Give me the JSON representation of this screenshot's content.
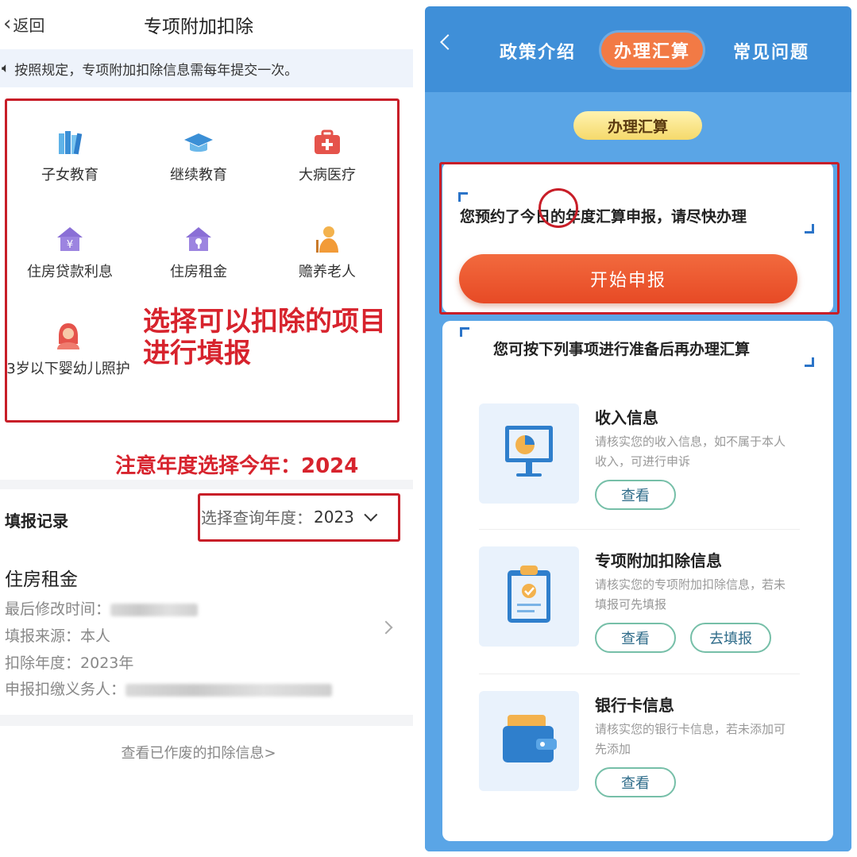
{
  "left": {
    "back_label": "返回",
    "title": "专项附加扣除",
    "notice": "按照规定，专项附加扣除信息需每年提交一次。",
    "items": [
      {
        "label": "子女教育",
        "icon": "books-icon"
      },
      {
        "label": "继续教育",
        "icon": "graduation-cap-icon"
      },
      {
        "label": "大病医疗",
        "icon": "medical-kit-icon"
      },
      {
        "label": "住房贷款利息",
        "icon": "house-yuan-icon"
      },
      {
        "label": "住房租金",
        "icon": "house-key-icon"
      },
      {
        "label": "赡养老人",
        "icon": "elderly-icon"
      },
      {
        "label": "3岁以下婴幼儿照护",
        "icon": "infant-care-icon"
      }
    ],
    "annotation_select": "选择可以扣除的项目进行填报",
    "annotation_year": "注意年度选择今年：2024",
    "records_title": "填报记录",
    "year_select_label": "选择查询年度：",
    "year_select_value": "2023",
    "record": {
      "name": "住房租金",
      "modified_label": "最后修改时间：",
      "source_label": "填报来源：",
      "source_value": "本人",
      "year_label": "扣除年度：",
      "year_value": "2023年",
      "withholder_label": "申报扣缴义务人："
    },
    "void_link": "查看已作废的扣除信息>"
  },
  "right": {
    "tabs": [
      "政策介绍",
      "办理汇算",
      "常见问题"
    ],
    "section_pill": "办理汇算",
    "appointment_text": "您预约了今日的年度汇算申报，请尽快办理",
    "start_button": "开始申报",
    "prep_text": "您可按下列事项进行准备后再办理汇算",
    "prep_items": [
      {
        "title": "收入信息",
        "desc": "请核实您的收入信息，如不属于本人收入，可进行申诉",
        "buttons": [
          "查看"
        ]
      },
      {
        "title": "专项附加扣除信息",
        "desc": "请核实您的专项附加扣除信息，若未填报可先填报",
        "buttons": [
          "查看",
          "去填报"
        ]
      },
      {
        "title": "银行卡信息",
        "desc": "请核实您的银行卡信息，若未添加可先添加",
        "buttons": [
          "查看"
        ]
      }
    ]
  },
  "colors": {
    "annotation_red": "#d7232d",
    "accent_orange": "#e74a25",
    "panel_blue": "#3f8fd8"
  }
}
